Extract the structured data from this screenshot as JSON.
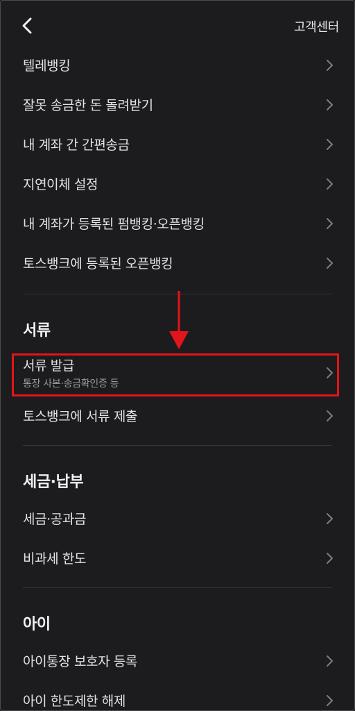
{
  "header": {
    "help_label": "고객센터"
  },
  "groups": {
    "transfer": {
      "items": [
        {
          "label": "텔레뱅킹"
        },
        {
          "label": "잘못 송금한 돈 돌려받기"
        },
        {
          "label": "내 계좌 간 간편송금"
        },
        {
          "label": "지연이체 설정"
        },
        {
          "label": "내 계좌가 등록된 펌뱅킹·오픈뱅킹"
        },
        {
          "label": "토스뱅크에 등록된 오픈뱅킹"
        }
      ]
    },
    "documents": {
      "title": "서류",
      "items": [
        {
          "label": "서류 발급",
          "sub": "통장 사본·송금확인증 등"
        },
        {
          "label": "토스뱅크에 서류 제출"
        }
      ]
    },
    "tax": {
      "title": "세금·납부",
      "items": [
        {
          "label": "세금·공과금"
        },
        {
          "label": "비과세 한도"
        }
      ]
    },
    "kids": {
      "title": "아이",
      "items": [
        {
          "label": "아이통장 보호자 등록"
        },
        {
          "label": "아이 한도제한 해제"
        }
      ]
    }
  },
  "annotation": {
    "highlight_color": "#e4141b"
  },
  "icons": {
    "back": "chevron-left-icon",
    "row": "chevron-right-icon"
  }
}
